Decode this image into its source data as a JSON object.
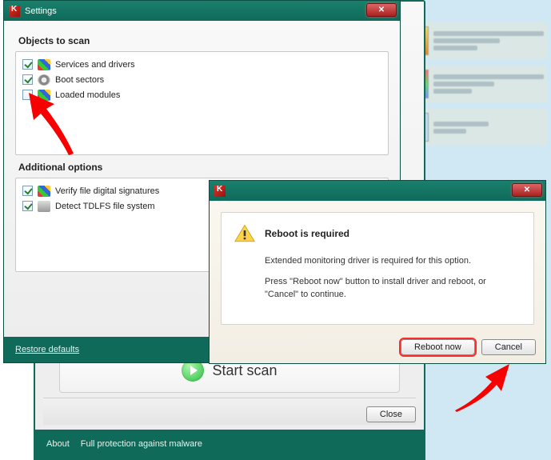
{
  "background": {
    "visible": true
  },
  "mainWindow": {
    "startLabel": "Start scan",
    "closeLabel": "Close",
    "footer": {
      "about": "About",
      "fullProtection": "Full protection against malware"
    }
  },
  "settings": {
    "title": "Settings",
    "sections": {
      "objects": {
        "heading": "Objects to scan",
        "items": [
          {
            "label": "Services and drivers",
            "checked": true,
            "icon": "flag"
          },
          {
            "label": "Boot sectors",
            "checked": true,
            "icon": "disk"
          },
          {
            "label": "Loaded modules",
            "checked": false,
            "icon": "flag"
          }
        ]
      },
      "additional": {
        "heading": "Additional options",
        "items": [
          {
            "label": "Verify file digital signatures",
            "checked": true,
            "icon": "flag"
          },
          {
            "label": "Detect TDLFS file system",
            "checked": true,
            "icon": "drive"
          }
        ]
      }
    },
    "restoreDefaults": "Restore defaults"
  },
  "dialog": {
    "title": "Reboot is required",
    "line1": "Extended monitoring driver is required for this option.",
    "line2": "Press \"Reboot now\" button to install driver and reboot, or \"Cancel\" to continue.",
    "rebootLabel": "Reboot now",
    "cancelLabel": "Cancel"
  },
  "annotations": {
    "arrow1_target": "loaded-modules-checkbox",
    "arrow2_target": "reboot-now-button"
  }
}
